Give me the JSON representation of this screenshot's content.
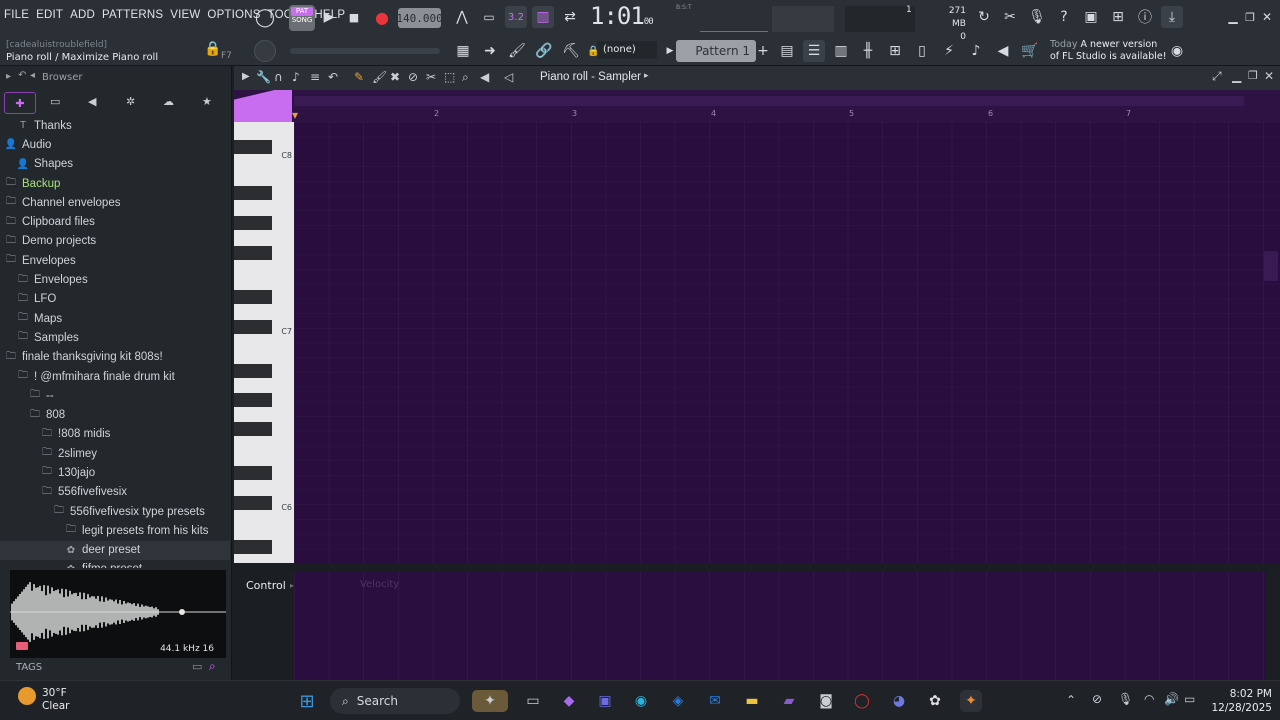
{
  "menu": [
    "FILE",
    "EDIT",
    "ADD",
    "PATTERNS",
    "VIEW",
    "OPTIONS",
    "TOOLS",
    "HELP"
  ],
  "transport": {
    "pat_song": [
      "PAT",
      "SONG"
    ],
    "tempo": "140.000",
    "time": "1:01",
    "time_small": "00",
    "time_unit": "B:S:T",
    "step_label": "3.2",
    "memory_top": "271 MB",
    "memory_bottom": "0",
    "cpu_num": "1"
  },
  "hint": {
    "line1": "[cadealuistroublefield]",
    "line2": "Piano roll / Maximize Piano roll",
    "shortcut": "F7"
  },
  "channel_select": "(none)",
  "pattern_name": "Pattern 1",
  "news": {
    "prefix": "Today",
    "text": "A newer version of FL Studio is available!"
  },
  "browser": {
    "title": "Browser",
    "tree": [
      {
        "label": "Thanks",
        "icon": "T",
        "indent": 2,
        "hl": false
      },
      {
        "label": "Audio",
        "icon": "👤",
        "indent": 1,
        "hl": false
      },
      {
        "label": "Shapes",
        "icon": "👤",
        "indent": 2,
        "hl": false
      },
      {
        "label": "Backup",
        "icon": "▭",
        "indent": 1,
        "hl": true
      },
      {
        "label": "Channel envelopes",
        "icon": "▭",
        "indent": 1,
        "hl": false
      },
      {
        "label": "Clipboard files",
        "icon": "▭",
        "indent": 1,
        "hl": false
      },
      {
        "label": "Demo projects",
        "icon": "▭",
        "indent": 1,
        "hl": false
      },
      {
        "label": "Envelopes",
        "icon": "▭",
        "indent": 1,
        "hl": false
      },
      {
        "label": "Envelopes",
        "icon": "▭",
        "indent": 2,
        "hl": false
      },
      {
        "label": "LFO",
        "icon": "▭",
        "indent": 2,
        "hl": false
      },
      {
        "label": "Maps",
        "icon": "▭",
        "indent": 2,
        "hl": false
      },
      {
        "label": "Samples",
        "icon": "▭",
        "indent": 2,
        "hl": false
      },
      {
        "label": "finale thanksgiving kit 808s!",
        "icon": "▭",
        "indent": 1,
        "hl": false
      },
      {
        "label": "!  @mfmihara finale drum kit",
        "icon": "▭",
        "indent": 2,
        "hl": false
      },
      {
        "label": "--",
        "icon": "▭",
        "indent": 3,
        "hl": false
      },
      {
        "label": "808",
        "icon": "▭",
        "indent": 3,
        "hl": false
      },
      {
        "label": "!808 midis",
        "icon": "▭",
        "indent": 4,
        "hl": false
      },
      {
        "label": "2slimey",
        "icon": "▭",
        "indent": 4,
        "hl": false
      },
      {
        "label": "130jajo",
        "icon": "▭",
        "indent": 4,
        "hl": false
      },
      {
        "label": "556fivefivesix",
        "icon": "▭",
        "indent": 4,
        "hl": false
      },
      {
        "label": "556fivefivesix type presets",
        "icon": "▭",
        "indent": 5,
        "hl": false
      },
      {
        "label": "legit presets from his kits",
        "icon": "▭",
        "indent": 6,
        "hl": false
      },
      {
        "label": "deer preset",
        "icon": "✿",
        "indent": 6,
        "hl": false,
        "selected": true
      },
      {
        "label": "fifme preset",
        "icon": "✿",
        "indent": 6,
        "hl": false
      }
    ],
    "sample_rate": "44.1 kHz",
    "bit_depth": "16",
    "tags_label": "TAGS"
  },
  "piano_roll": {
    "title": "Piano roll - Sampler",
    "ruler_marks": [
      "2",
      "3",
      "4",
      "5",
      "6",
      "7"
    ],
    "octaves": [
      "C8",
      "C7",
      "C6"
    ],
    "control_label": "Control",
    "control_target": "Velocity"
  },
  "taskbar": {
    "temperature": "30°F",
    "condition": "Clear",
    "search": "Search",
    "time": "8:02 PM",
    "date": "12/28/2025"
  }
}
